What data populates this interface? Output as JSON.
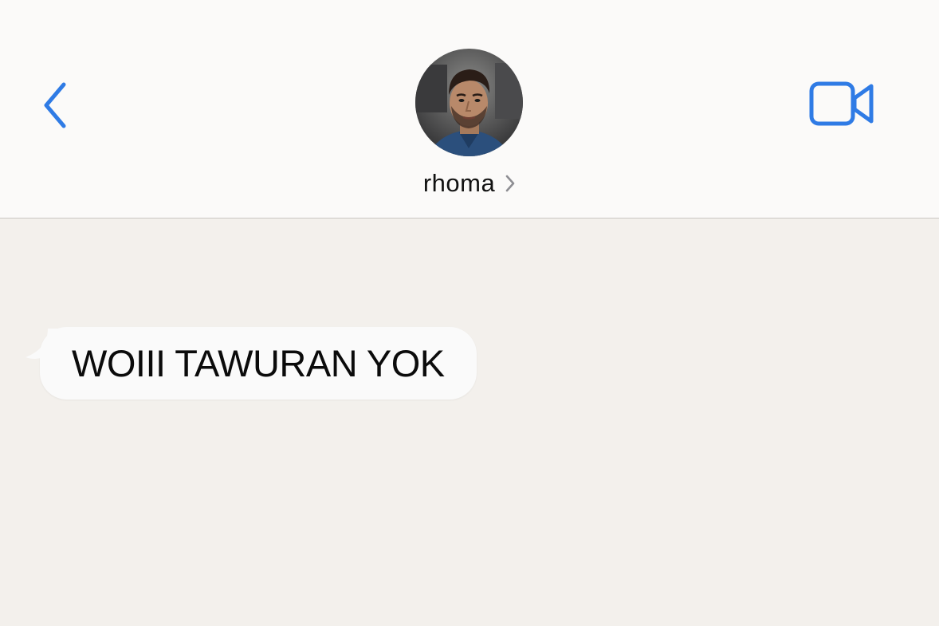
{
  "header": {
    "contact_name": "rhoma",
    "icons": {
      "back": "chevron-left-icon",
      "video": "video-camera-icon",
      "disclosure": "chevron-right-icon"
    }
  },
  "thread": {
    "messages": [
      {
        "direction": "incoming",
        "text": "WOIII TAWURAN YOK"
      }
    ]
  },
  "colors": {
    "accent": "#2f7be5",
    "header_bg": "#fbfaf9",
    "thread_bg": "#f3f0ec",
    "bubble_bg": "#fafafa",
    "text": "#111111"
  }
}
